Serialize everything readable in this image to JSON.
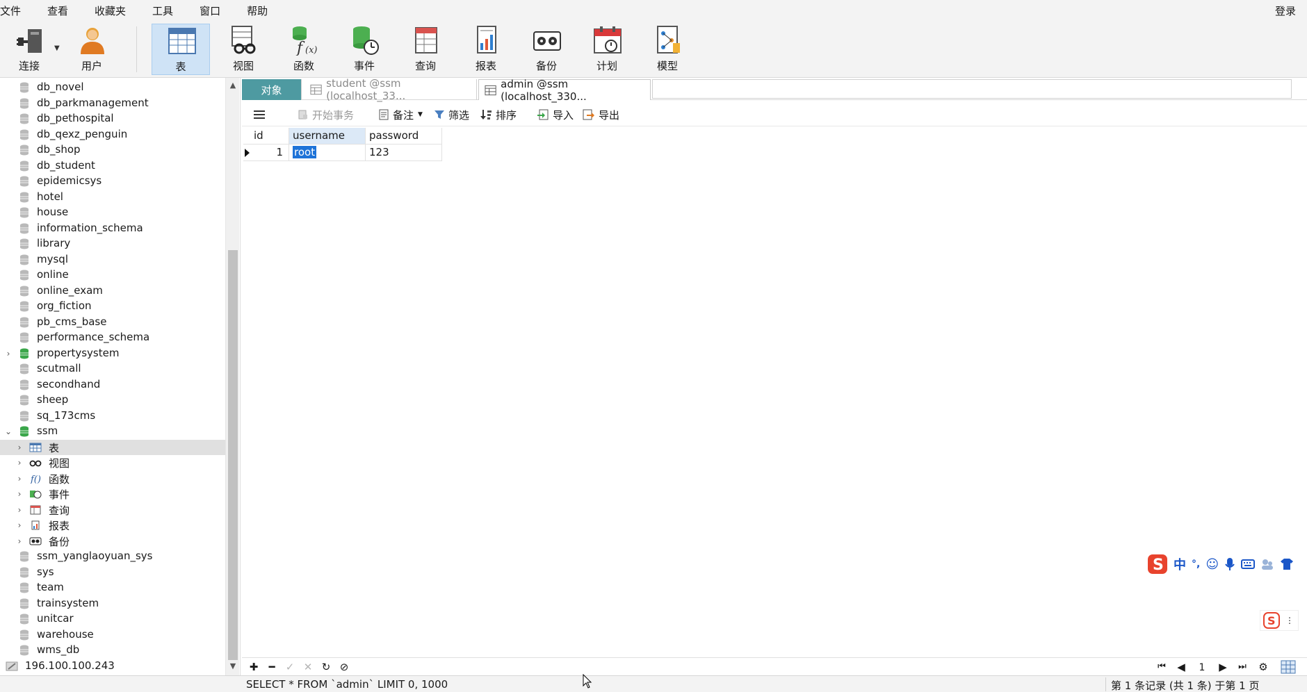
{
  "menu": {
    "items": [
      "文件",
      "查看",
      "收藏夹",
      "工具",
      "窗口",
      "帮助"
    ],
    "login": "登录"
  },
  "toolbar": {
    "connect": "连接",
    "user": "用户",
    "table": "表",
    "view": "视图",
    "function": "函数",
    "event": "事件",
    "query": "查询",
    "report": "报表",
    "backup": "备份",
    "schedule": "计划",
    "model": "模型"
  },
  "sidebar": {
    "databases": [
      {
        "name": "db_novel",
        "open": false
      },
      {
        "name": "db_parkmanagement",
        "open": false
      },
      {
        "name": "db_pethospital",
        "open": false
      },
      {
        "name": "db_qexz_penguin",
        "open": false
      },
      {
        "name": "db_shop",
        "open": false
      },
      {
        "name": "db_student",
        "open": false
      },
      {
        "name": "epidemicsys",
        "open": false
      },
      {
        "name": "hotel",
        "open": false
      },
      {
        "name": "house",
        "open": false
      },
      {
        "name": "information_schema",
        "open": false
      },
      {
        "name": "library",
        "open": false
      },
      {
        "name": "mysql",
        "open": false
      },
      {
        "name": "online",
        "open": false
      },
      {
        "name": "online_exam",
        "open": false
      },
      {
        "name": "org_fiction",
        "open": false
      },
      {
        "name": "pb_cms_base",
        "open": false
      },
      {
        "name": "performance_schema",
        "open": false
      },
      {
        "name": "propertysystem",
        "open": true,
        "expanded": false
      },
      {
        "name": "scutmall",
        "open": false
      },
      {
        "name": "secondhand",
        "open": false
      },
      {
        "name": "sheep",
        "open": false
      },
      {
        "name": "sq_173cms",
        "open": false
      },
      {
        "name": "ssm",
        "open": true,
        "expanded": true
      }
    ],
    "ssm_children": [
      "表",
      "视图",
      "函数",
      "事件",
      "查询",
      "报表",
      "备份"
    ],
    "databases_after": [
      "ssm_yanglaoyuan_sys",
      "sys",
      "team",
      "trainsystem",
      "unitcar",
      "warehouse",
      "wms_db"
    ],
    "connection": "196.100.100.243"
  },
  "tabs": {
    "objects": "对象",
    "tab1": "student @ssm (localhost_33...",
    "tab2": "admin @ssm (localhost_330..."
  },
  "datatoolbar": {
    "begin_tx": "开始事务",
    "note": "备注",
    "filter": "筛选",
    "sort": "排序",
    "import": "导入",
    "export": "导出"
  },
  "grid": {
    "columns": [
      "id",
      "username",
      "password"
    ],
    "rows": [
      [
        "1",
        "root",
        "123"
      ]
    ]
  },
  "nav": {
    "page": "1"
  },
  "status": {
    "sql": "SELECT * FROM `admin` LIMIT 0, 1000",
    "records": "第 1 条记录 (共 1 条) 于第 1 页"
  },
  "ime": {
    "zh": "中"
  },
  "colors": {
    "accent": "#4e9aa1",
    "selection": "#1e73d8",
    "db_open": "#3aa64a",
    "db_closed": "#b9b9b9"
  }
}
